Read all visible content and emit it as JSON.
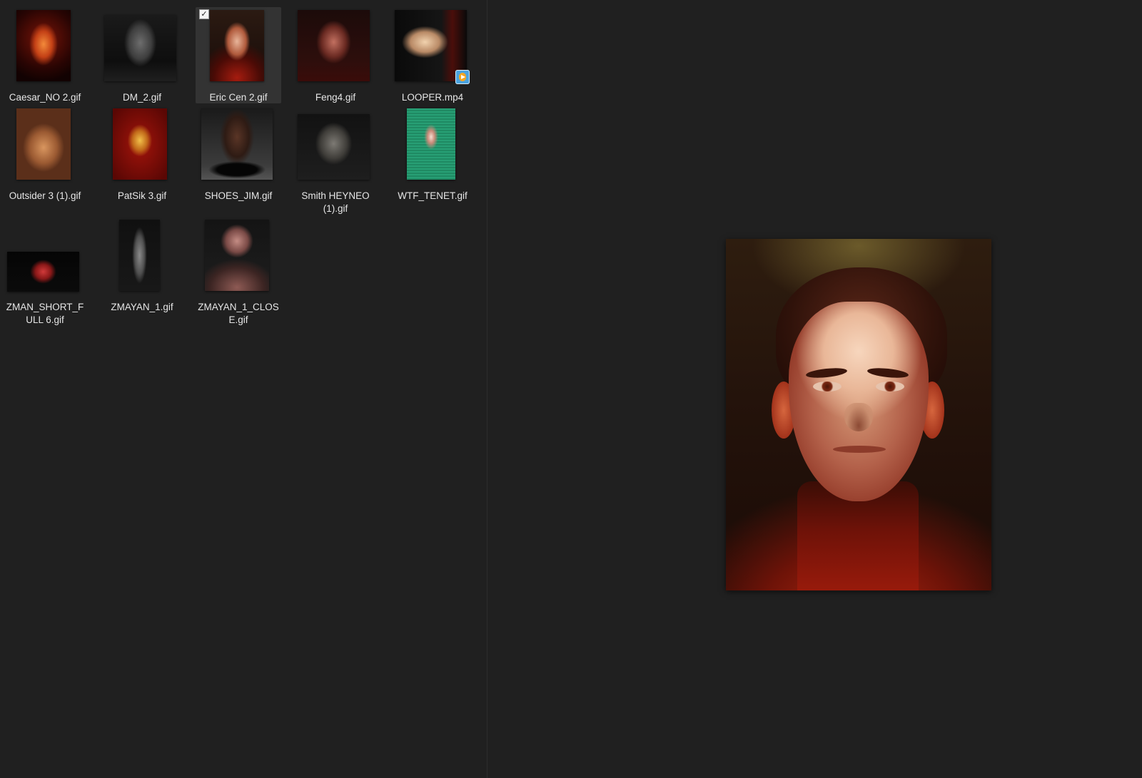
{
  "files": [
    {
      "name": "Caesar_NO 2.gif",
      "selected": false
    },
    {
      "name": "DM_2.gif",
      "selected": false
    },
    {
      "name": "Eric Cen 2.gif",
      "selected": true
    },
    {
      "name": "Feng4.gif",
      "selected": false
    },
    {
      "name": "LOOPER.mp4",
      "selected": false,
      "badge": "media-player-icon"
    },
    {
      "name": "Outsider 3 (1).gif",
      "selected": false
    },
    {
      "name": "PatSik 3.gif",
      "selected": false
    },
    {
      "name": "SHOES_JIM.gif",
      "selected": false
    },
    {
      "name": "Smith HEYNEO (1).gif",
      "selected": false
    },
    {
      "name": "WTF_TENET.gif",
      "selected": false
    },
    {
      "name": "ZMAN_SHORT_FULL 6.gif",
      "selected": false
    },
    {
      "name": "ZMAYAN_1.gif",
      "selected": false
    },
    {
      "name": "ZMAYAN_1_CLOSE.gif",
      "selected": false
    }
  ],
  "selection_check": "✓",
  "preview": {
    "subject": "portrait of a young man with red lighting"
  },
  "colors": {
    "background": "#202020",
    "selected_tile": "#333333",
    "label_text": "#e6e6e6"
  }
}
